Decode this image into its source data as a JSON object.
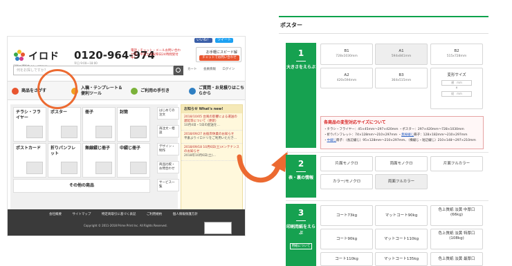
{
  "site": {
    "sns": [
      "いいね！",
      "ツイート"
    ],
    "logo": "イロドリ",
    "logo_sub": "印刷の通販サイト イロドリ",
    "phone": "0120-964-974",
    "phone_sub": "平日 9:00〜18:00",
    "red_note": "電話・チャット・メールお問い合わせ可。平日土日祝祭日24時間受付中！",
    "quote_line1": "お手軽にスピード解決！",
    "quote_line2": "チャットでお問い合わせ",
    "search_placeholder": "何をお探しですか？",
    "header_links": [
      "カート",
      "会員情報",
      "ログイン"
    ],
    "gnav": [
      {
        "label": "商品をさがす",
        "color": "#e8552f"
      },
      {
        "label": "入稿・テンプレート＆便利ツール",
        "color": "#f0a020"
      },
      {
        "label": "ご利用の手引き",
        "color": "#7bb23a"
      },
      {
        "label": "ご質問・お見積りはこちらから",
        "color": "#2f7fc2"
      }
    ],
    "tiles": {
      "flyer": "チラシ・フライヤー",
      "poster": "ポスター",
      "booklet": "冊子",
      "envelope": "封筒",
      "postcard": "ポストカード",
      "pamphlet": "折りパンフレット",
      "nonbind": "無線綴じ冊子",
      "saddle": "中綴じ冊子",
      "other": "その他の商品"
    },
    "side_buttons": [
      "はじめての注文",
      "再注文・相談",
      "デザイン・制作",
      "商品比較・お問合わせ",
      "サービス一覧"
    ],
    "news_title": "お知らせ What's new!",
    "news": [
      {
        "date": "2018/10/05",
        "title": "台風の影響による運送の遅延等について（更新）",
        "body": "10月4日・5日の配送を…"
      },
      {
        "date": "2018/09/27",
        "title": "お彼岸休業のお知らせ",
        "body": "平素よりイロドリをご利用いただき…"
      },
      {
        "date": "2018/09/18",
        "title": "10月6日(土)メンテナンスのお知らせ",
        "body": "2018年10月6日(土)…"
      }
    ],
    "footer_links": [
      "会社概要",
      "サイトマップ",
      "特定商取引に基づく表記",
      "ご利用規約",
      "個人情報保護方針"
    ],
    "copyright": "Copyright © 2011-2018 Prime Print Inc. All Rights Reserved."
  },
  "panel": {
    "title": "ポスター",
    "step1": {
      "num": "1",
      "label": "大きさをえらぶ"
    },
    "sizes": [
      {
        "name": "B1",
        "dim": "728x1030mm"
      },
      {
        "name": "A1",
        "dim": "594x841mm"
      },
      {
        "name": "B2",
        "dim": "515x728mm"
      },
      {
        "name": "A2",
        "dim": "420x594mm"
      },
      {
        "name": "B3",
        "dim": "364x515mm"
      }
    ],
    "custom": {
      "label": "変形サイズ",
      "w_placeholder": "横　mm",
      "x": "x",
      "h_placeholder": "縦　mm"
    },
    "irregular": {
      "title": "各商品の変型対応サイズについて",
      "line1_a": "・チラシ・フライヤー：45×45mm〜297×420mm",
      "line1_b": "・ポスター：297×420mm〜728×1030mm",
      "line2_a": "・折りパンフレット：74×128mm〜210×297mm",
      "line2_link": "無線綴じ",
      "line2_b": "冊子：128×182mm〜210×297mm",
      "line3_link": "中綴じ",
      "line3_b": "冊子：（長辺綴じ）95×128mm〜210×297mm、（横綴じ・短辺綴じ）210×148〜297×210mm"
    },
    "step2": {
      "num": "2",
      "label": "表・裏の情報"
    },
    "colors": [
      "片面モノクロ",
      "両面モノクロ",
      "片面フルカラー",
      "カラー/モノクロ",
      "両面フルカラー"
    ],
    "step3": {
      "num": "3",
      "label": "印刷用紙をえらぶ",
      "note": "用紙について"
    },
    "papers": [
      "コート73kg",
      "マットコート90kg",
      "色上質紙 淡黄 中厚口(66kg)",
      "コート90kg",
      "マットコート110kg",
      "色上質紙 淡黄 特厚口(108kg)",
      "コート110kg",
      "マットコート135kg",
      "色上質紙 淡黄 最厚口"
    ]
  }
}
